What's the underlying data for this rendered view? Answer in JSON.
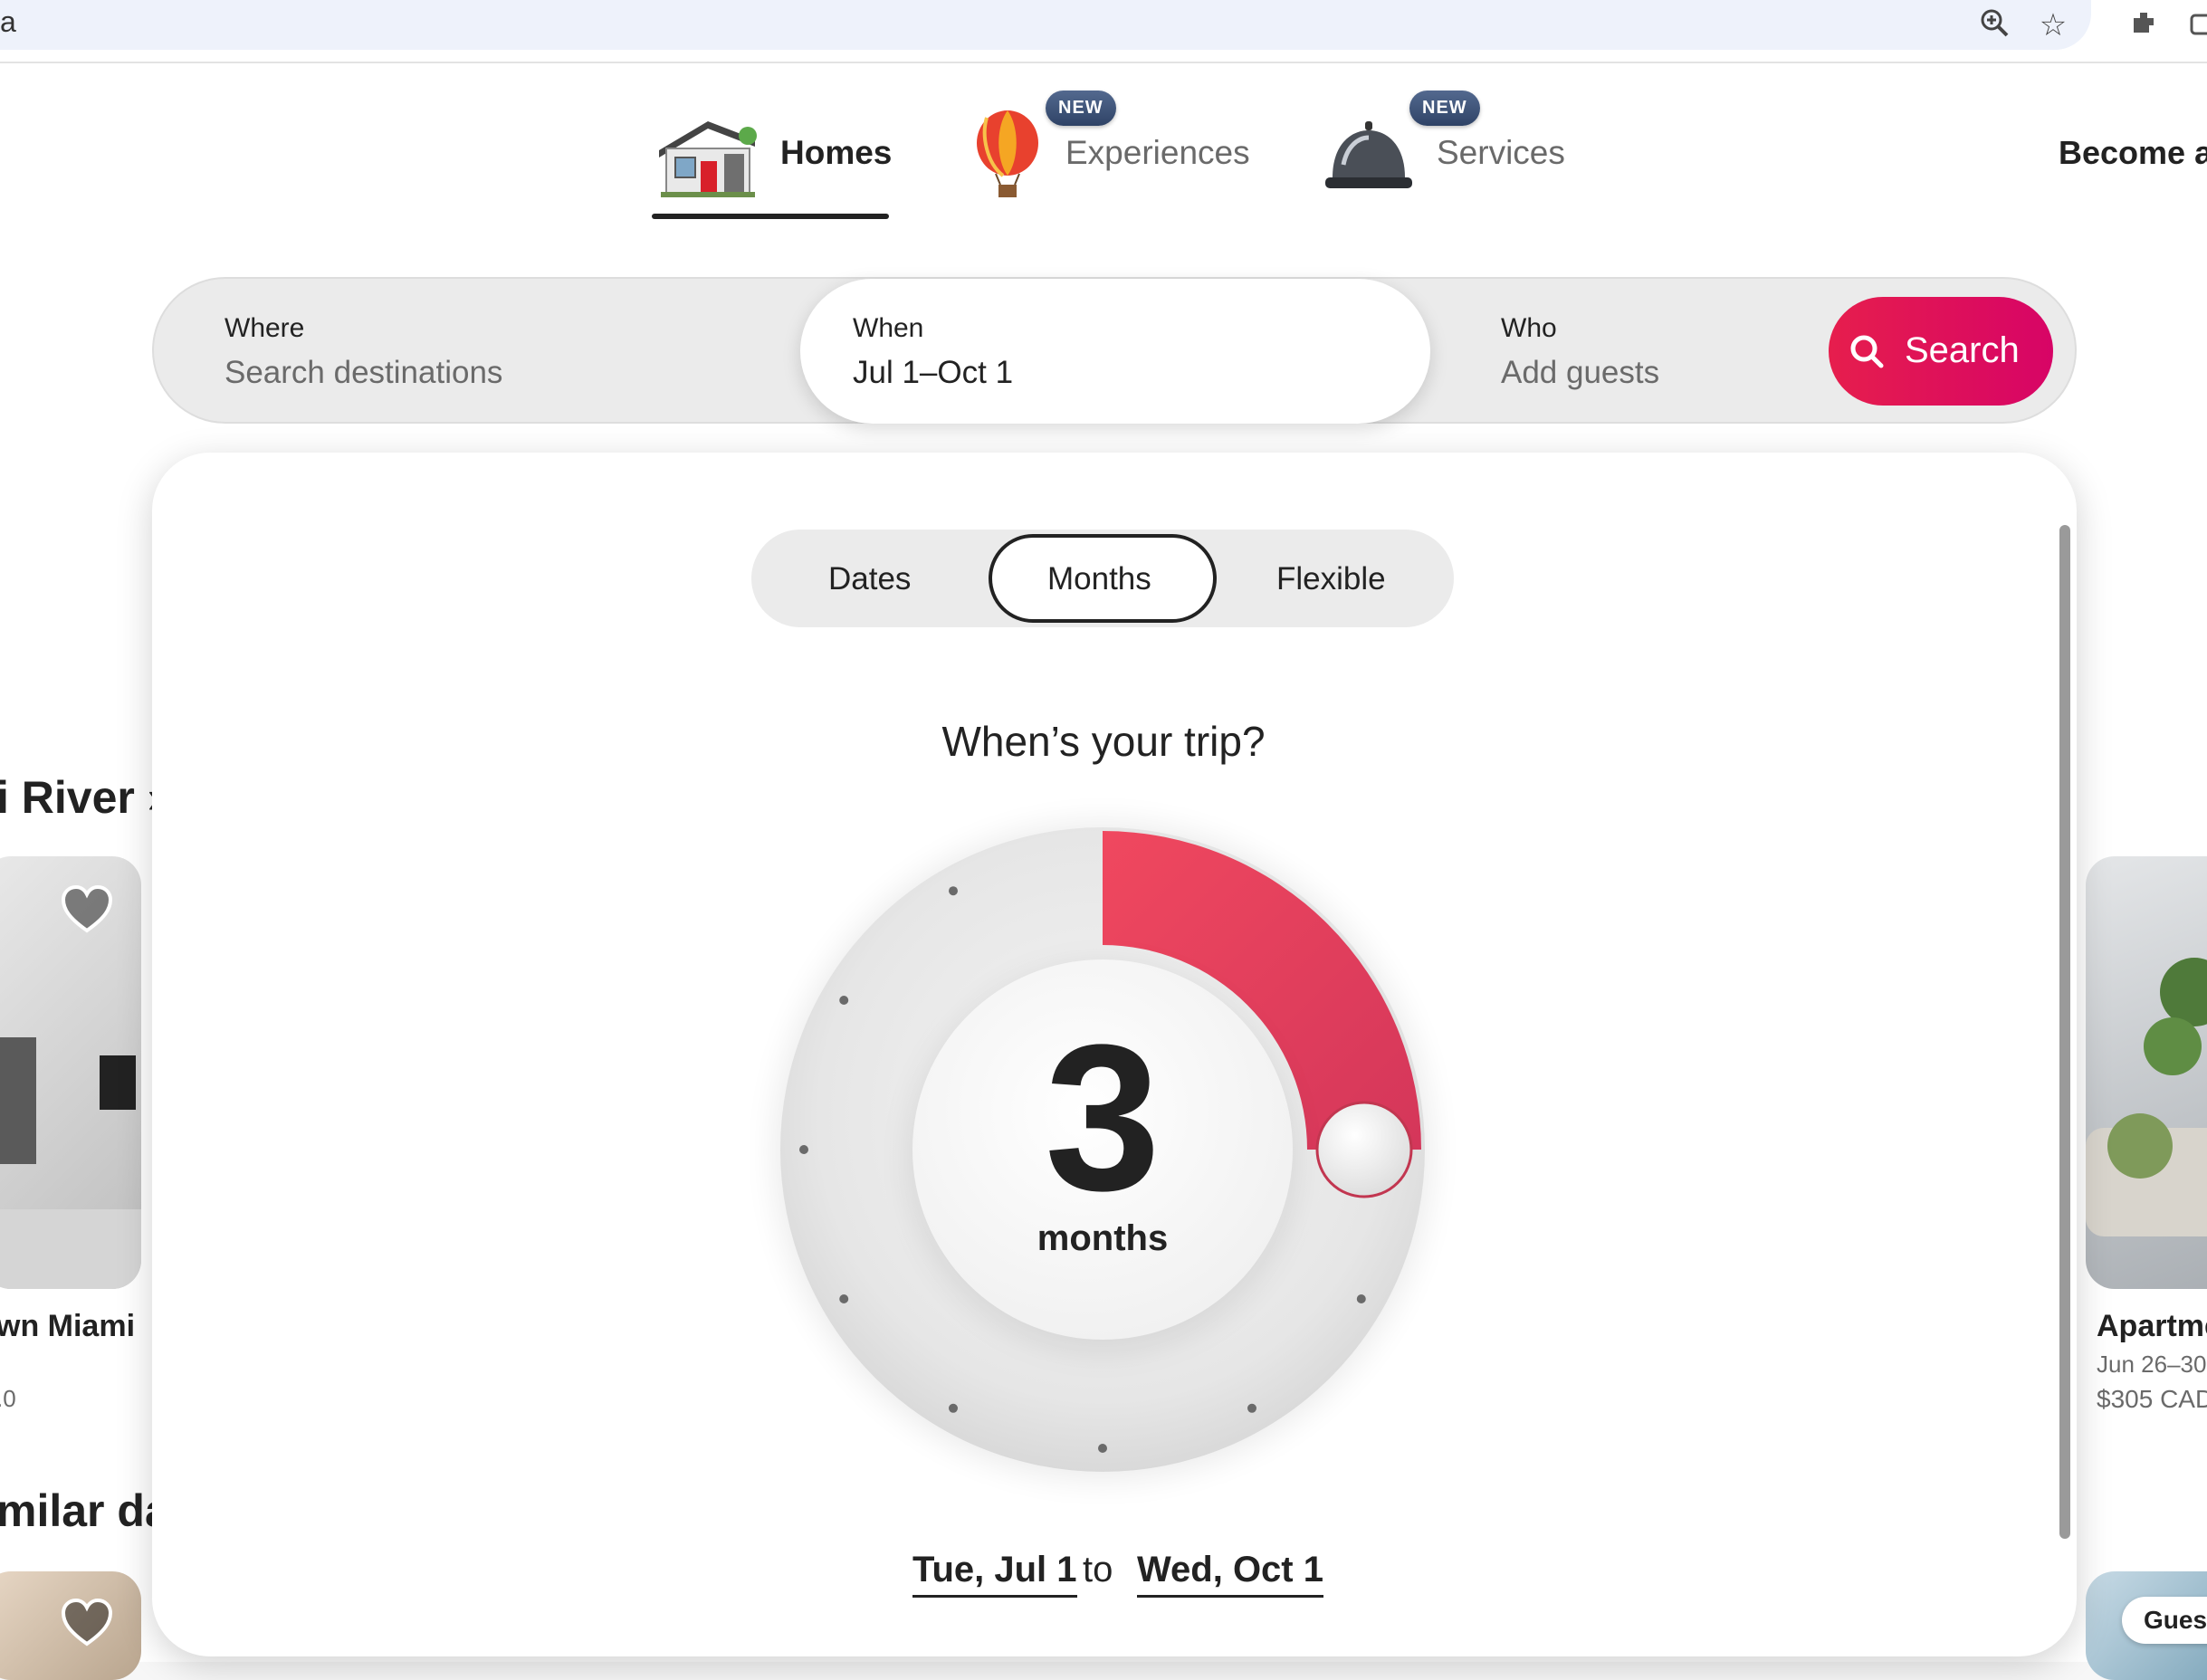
{
  "browser": {
    "address_text": "a",
    "icons": [
      "zoom-icon",
      "star-icon",
      "extension-icon",
      "camera-icon"
    ]
  },
  "nav": {
    "items": [
      {
        "label": "Homes",
        "active": true,
        "icon": "house-icon"
      },
      {
        "label": "Experiences",
        "badge": "NEW",
        "icon": "hot-air-balloon-icon"
      },
      {
        "label": "Services",
        "badge": "NEW",
        "icon": "service-bell-icon"
      }
    ],
    "host_link": "Become a"
  },
  "search": {
    "where_label": "Where",
    "where_placeholder": "Search destinations",
    "when_label": "When",
    "when_value": "Jul 1–Oct 1",
    "who_label": "Who",
    "who_placeholder": "Add guests",
    "button_label": "Search"
  },
  "background": {
    "left_heading": "i River ›",
    "left_card_title": "wn Miami",
    "left_card_meta": ".0",
    "left_heading_2": "milar da",
    "right_card_title": "Apartme",
    "right_card_dates": "Jun 26–30",
    "right_card_price": "$305 CAD",
    "right_badge": "Guest"
  },
  "panel": {
    "tabs": [
      "Dates",
      "Months",
      "Flexible"
    ],
    "active_tab": "Months",
    "question": "When’s your trip?",
    "dial": {
      "value": "3",
      "unit": "months",
      "selected_months": 3,
      "total_months": 12,
      "accent": "#e0324f"
    },
    "start_date": "Tue, Jul 1",
    "connector": "to",
    "end_date": "Wed, Oct 1"
  }
}
